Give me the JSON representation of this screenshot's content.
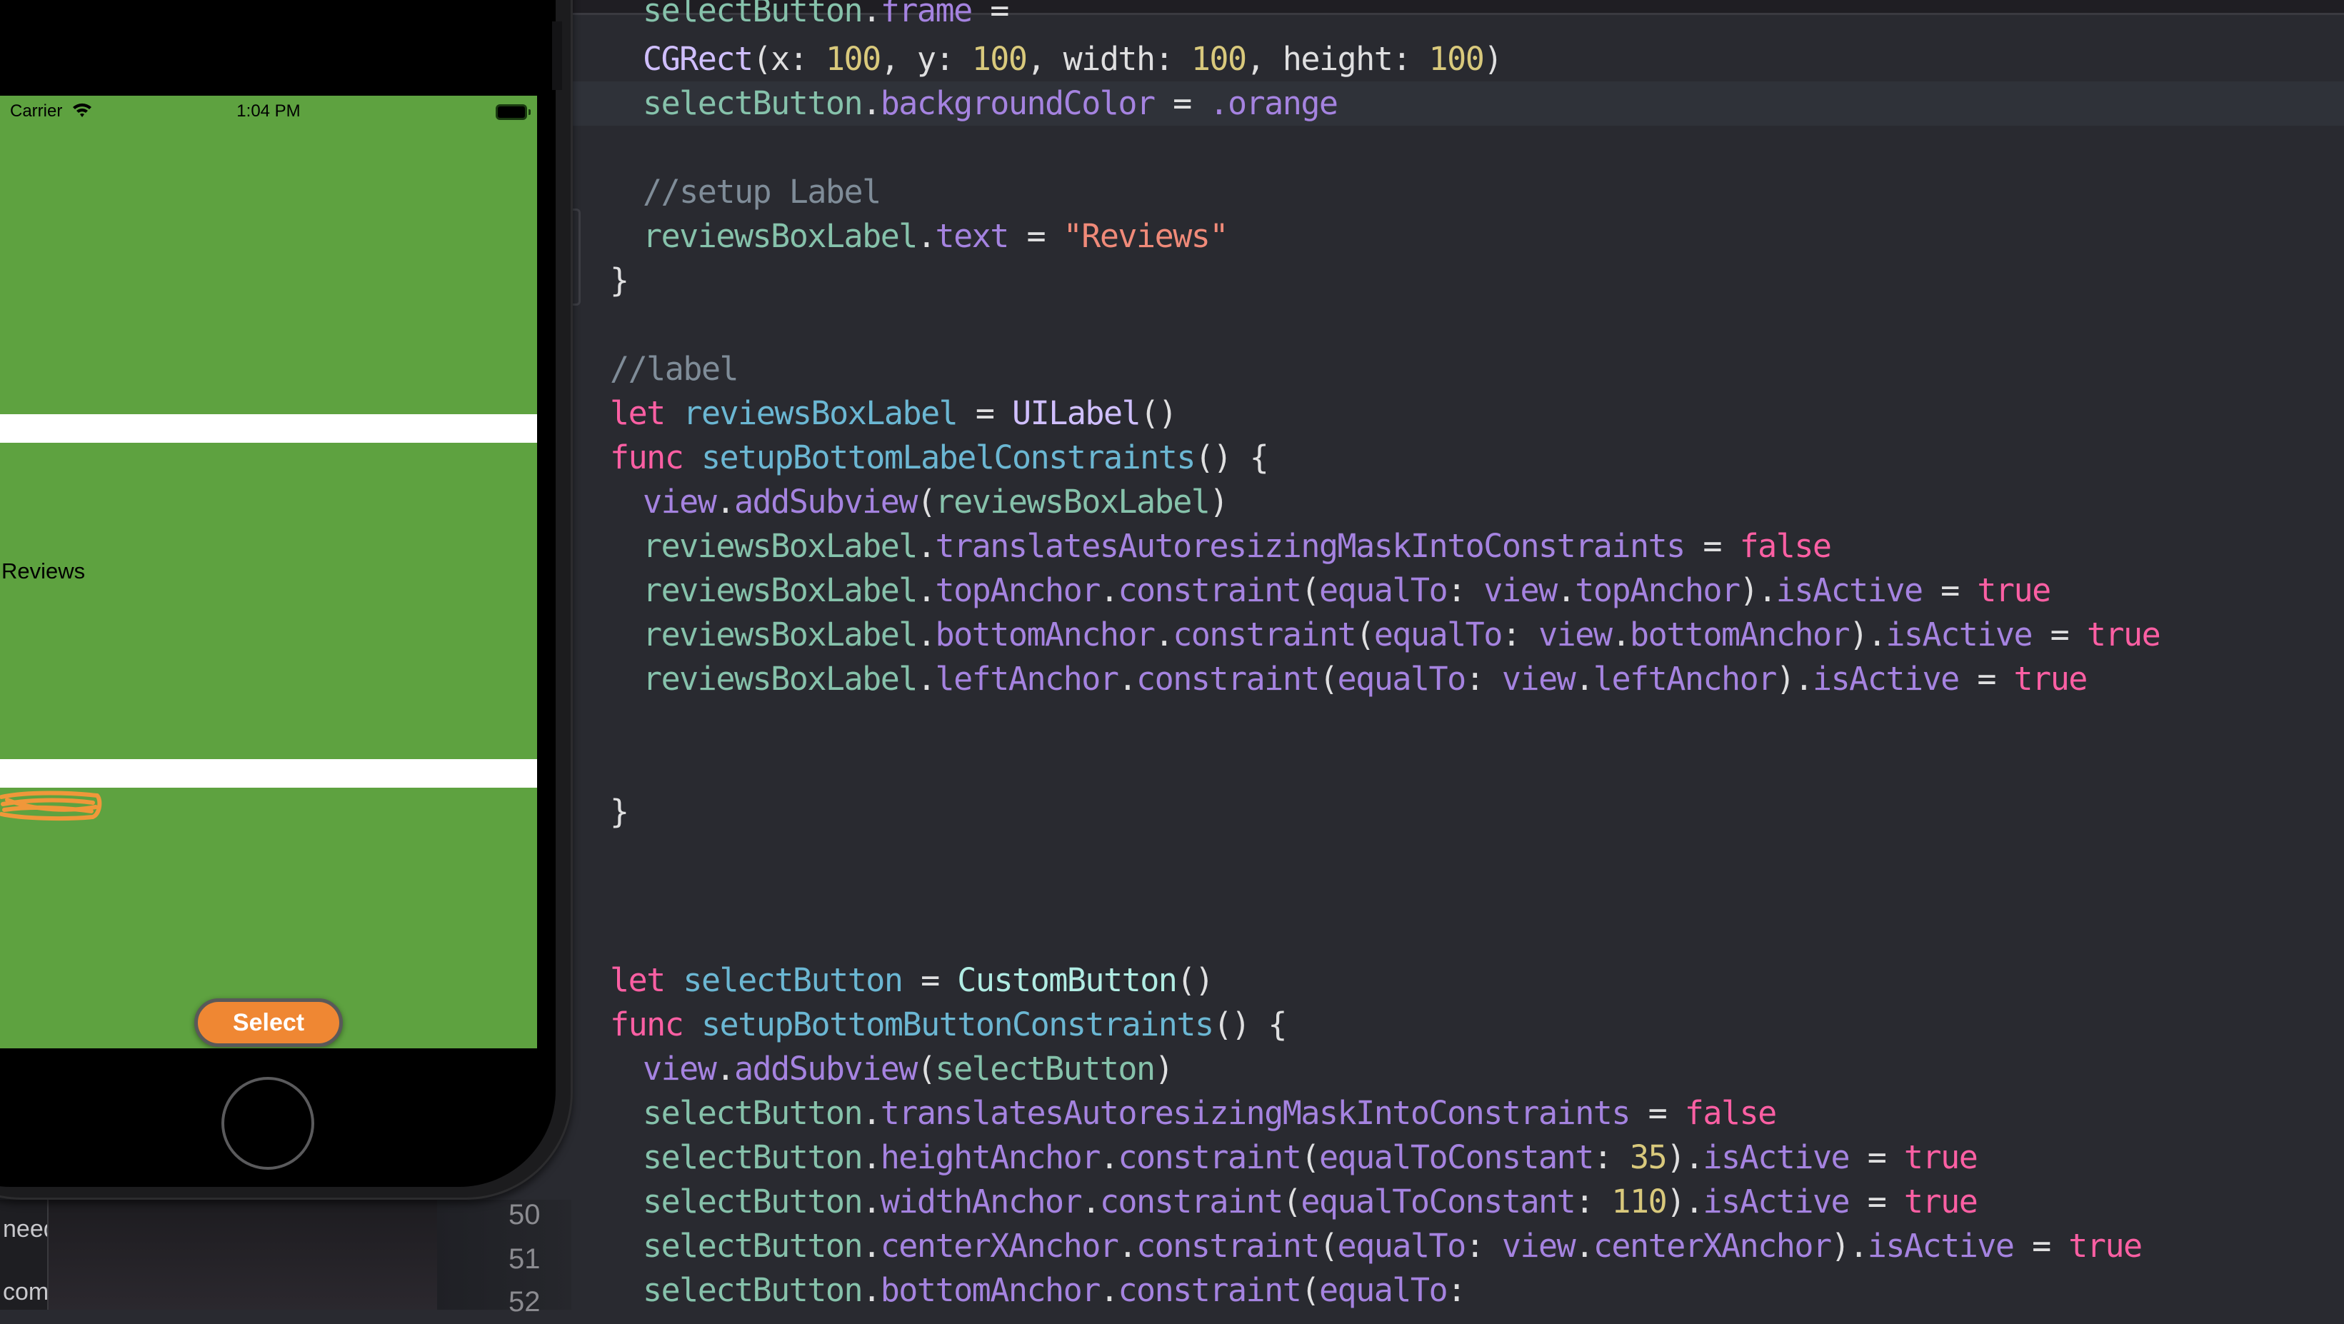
{
  "simulator": {
    "status_bar": {
      "carrier": "Carrier",
      "time": "1:04 PM",
      "wifi_icon": "wifi-icon",
      "battery_icon": "battery-icon"
    },
    "screen_background": "#5ea240",
    "reviews_label": "Reviews",
    "select_button": {
      "label": "Select",
      "color": "#ef8733"
    },
    "home_button_icon": "home-button"
  },
  "navigator": {
    "partial_texts": [
      "need",
      "com"
    ]
  },
  "editor": {
    "line_numbers": [
      "50",
      "51",
      "52"
    ],
    "lines": [
      {
        "indent": 1,
        "tokens": [
          [
            "var",
            "selectButton"
          ],
          [
            "pl",
            "."
          ],
          [
            "prop",
            "frame"
          ],
          [
            "op",
            " = "
          ]
        ]
      },
      {
        "indent": 1,
        "tokens": [
          [
            "type",
            "CGRect"
          ],
          [
            "pl",
            "("
          ],
          [
            "pl",
            "x"
          ],
          [
            "pl",
            ": "
          ],
          [
            "num",
            "100"
          ],
          [
            "pl",
            ", "
          ],
          [
            "pl",
            "y"
          ],
          [
            "pl",
            ": "
          ],
          [
            "num",
            "100"
          ],
          [
            "pl",
            ", "
          ],
          [
            "pl",
            "width"
          ],
          [
            "pl",
            ": "
          ],
          [
            "num",
            "100"
          ],
          [
            "pl",
            ", "
          ],
          [
            "pl",
            "height"
          ],
          [
            "pl",
            ": "
          ],
          [
            "num",
            "100"
          ],
          [
            "pl",
            ")"
          ]
        ]
      },
      {
        "indent": 1,
        "tokens": [
          [
            "var",
            "selectButton"
          ],
          [
            "pl",
            "."
          ],
          [
            "prop",
            "backgroundColor"
          ],
          [
            "op",
            " = "
          ],
          [
            "prop",
            ".orange"
          ]
        ]
      },
      {
        "indent": 1,
        "tokens": [
          [
            "com",
            "//setup Label"
          ]
        ]
      },
      {
        "indent": 1,
        "tokens": [
          [
            "var",
            "reviewsBoxLabel"
          ],
          [
            "pl",
            "."
          ],
          [
            "prop",
            "text"
          ],
          [
            "op",
            " = "
          ],
          [
            "str",
            "\"Reviews\""
          ]
        ]
      },
      {
        "indent": 0,
        "tokens": [
          [
            "pl",
            "}"
          ]
        ]
      },
      {
        "indent": 0,
        "tokens": [
          [
            "com",
            "//label"
          ]
        ]
      },
      {
        "indent": 0,
        "tokens": [
          [
            "k",
            "let"
          ],
          [
            "pl",
            " "
          ],
          [
            "decl",
            "reviewsBoxLabel"
          ],
          [
            "op",
            " = "
          ],
          [
            "type",
            "UILabel"
          ],
          [
            "pl",
            "()"
          ]
        ]
      },
      {
        "indent": 0,
        "tokens": [
          [
            "k",
            "func"
          ],
          [
            "pl",
            " "
          ],
          [
            "decl",
            "setupBottomLabelConstraints"
          ],
          [
            "pl",
            "() {"
          ]
        ]
      },
      {
        "indent": 1,
        "tokens": [
          [
            "prop",
            "view"
          ],
          [
            "pl",
            "."
          ],
          [
            "prop",
            "addSubview"
          ],
          [
            "pl",
            "("
          ],
          [
            "var",
            "reviewsBoxLabel"
          ],
          [
            "pl",
            ")"
          ]
        ]
      },
      {
        "indent": 1,
        "tokens": [
          [
            "var",
            "reviewsBoxLabel"
          ],
          [
            "pl",
            "."
          ],
          [
            "prop",
            "translatesAutoresizingMaskIntoConstraints"
          ],
          [
            "op",
            " = "
          ],
          [
            "k",
            "false"
          ]
        ]
      },
      {
        "indent": 1,
        "tokens": [
          [
            "var",
            "reviewsBoxLabel"
          ],
          [
            "pl",
            "."
          ],
          [
            "prop",
            "topAnchor"
          ],
          [
            "pl",
            "."
          ],
          [
            "prop",
            "constraint"
          ],
          [
            "pl",
            "("
          ],
          [
            "prop",
            "equalTo"
          ],
          [
            "pl",
            ": "
          ],
          [
            "prop",
            "view"
          ],
          [
            "pl",
            "."
          ],
          [
            "prop",
            "topAnchor"
          ],
          [
            "pl",
            ")."
          ],
          [
            "prop",
            "isActive"
          ],
          [
            "op",
            " = "
          ],
          [
            "k",
            "true"
          ]
        ]
      },
      {
        "indent": 1,
        "tokens": [
          [
            "var",
            "reviewsBoxLabel"
          ],
          [
            "pl",
            "."
          ],
          [
            "prop",
            "bottomAnchor"
          ],
          [
            "pl",
            "."
          ],
          [
            "prop",
            "constraint"
          ],
          [
            "pl",
            "("
          ],
          [
            "prop",
            "equalTo"
          ],
          [
            "pl",
            ": "
          ],
          [
            "prop",
            "view"
          ],
          [
            "pl",
            "."
          ],
          [
            "prop",
            "bottomAnchor"
          ],
          [
            "pl",
            ")."
          ],
          [
            "prop",
            "isActive"
          ],
          [
            "op",
            " = "
          ],
          [
            "k",
            "true"
          ]
        ]
      },
      {
        "indent": 1,
        "tokens": [
          [
            "var",
            "reviewsBoxLabel"
          ],
          [
            "pl",
            "."
          ],
          [
            "prop",
            "leftAnchor"
          ],
          [
            "pl",
            "."
          ],
          [
            "prop",
            "constraint"
          ],
          [
            "pl",
            "("
          ],
          [
            "prop",
            "equalTo"
          ],
          [
            "pl",
            ": "
          ],
          [
            "prop",
            "view"
          ],
          [
            "pl",
            "."
          ],
          [
            "prop",
            "leftAnchor"
          ],
          [
            "pl",
            ")."
          ],
          [
            "prop",
            "isActive"
          ],
          [
            "op",
            " = "
          ],
          [
            "k",
            "true"
          ]
        ]
      },
      {
        "indent": 0,
        "tokens": [
          [
            "pl",
            "}"
          ]
        ]
      },
      {
        "indent": 0,
        "tokens": [
          [
            "k",
            "let"
          ],
          [
            "pl",
            " "
          ],
          [
            "decl",
            "selectButton"
          ],
          [
            "op",
            " = "
          ],
          [
            "cls",
            "CustomButton"
          ],
          [
            "pl",
            "()"
          ]
        ]
      },
      {
        "indent": 0,
        "tokens": [
          [
            "k",
            "func"
          ],
          [
            "pl",
            " "
          ],
          [
            "decl",
            "setupBottomButtonConstraints"
          ],
          [
            "pl",
            "() {"
          ]
        ]
      },
      {
        "indent": 1,
        "tokens": [
          [
            "prop",
            "view"
          ],
          [
            "pl",
            "."
          ],
          [
            "prop",
            "addSubview"
          ],
          [
            "pl",
            "("
          ],
          [
            "var",
            "selectButton"
          ],
          [
            "pl",
            ")"
          ]
        ]
      },
      {
        "indent": 1,
        "tokens": [
          [
            "var",
            "selectButton"
          ],
          [
            "pl",
            "."
          ],
          [
            "prop",
            "translatesAutoresizingMaskIntoConstraints"
          ],
          [
            "op",
            " = "
          ],
          [
            "k",
            "false"
          ]
        ]
      },
      {
        "indent": 1,
        "tokens": [
          [
            "var",
            "selectButton"
          ],
          [
            "pl",
            "."
          ],
          [
            "prop",
            "heightAnchor"
          ],
          [
            "pl",
            "."
          ],
          [
            "prop",
            "constraint"
          ],
          [
            "pl",
            "("
          ],
          [
            "prop",
            "equalToConstant"
          ],
          [
            "pl",
            ": "
          ],
          [
            "num",
            "35"
          ],
          [
            "pl",
            ")."
          ],
          [
            "prop",
            "isActive"
          ],
          [
            "op",
            " = "
          ],
          [
            "k",
            "true"
          ]
        ]
      },
      {
        "indent": 1,
        "tokens": [
          [
            "var",
            "selectButton"
          ],
          [
            "pl",
            "."
          ],
          [
            "prop",
            "widthAnchor"
          ],
          [
            "pl",
            "."
          ],
          [
            "prop",
            "constraint"
          ],
          [
            "pl",
            "("
          ],
          [
            "prop",
            "equalToConstant"
          ],
          [
            "pl",
            ": "
          ],
          [
            "num",
            "110"
          ],
          [
            "pl",
            ")."
          ],
          [
            "prop",
            "isActive"
          ],
          [
            "op",
            " = "
          ],
          [
            "k",
            "true"
          ]
        ]
      },
      {
        "indent": 1,
        "tokens": [
          [
            "var",
            "selectButton"
          ],
          [
            "pl",
            "."
          ],
          [
            "prop",
            "centerXAnchor"
          ],
          [
            "pl",
            "."
          ],
          [
            "prop",
            "constraint"
          ],
          [
            "pl",
            "("
          ],
          [
            "prop",
            "equalTo"
          ],
          [
            "pl",
            ": "
          ],
          [
            "prop",
            "view"
          ],
          [
            "pl",
            "."
          ],
          [
            "prop",
            "centerXAnchor"
          ],
          [
            "pl",
            ")."
          ],
          [
            "prop",
            "isActive"
          ],
          [
            "op",
            " = "
          ],
          [
            "k",
            "true"
          ]
        ]
      },
      {
        "indent": 1,
        "tokens": [
          [
            "var",
            "selectButton"
          ],
          [
            "pl",
            "."
          ],
          [
            "prop",
            "bottomAnchor"
          ],
          [
            "pl",
            "."
          ],
          [
            "prop",
            "constraint"
          ],
          [
            "pl",
            "("
          ],
          [
            "prop",
            "equalTo"
          ],
          [
            "pl",
            ":"
          ]
        ]
      }
    ]
  }
}
